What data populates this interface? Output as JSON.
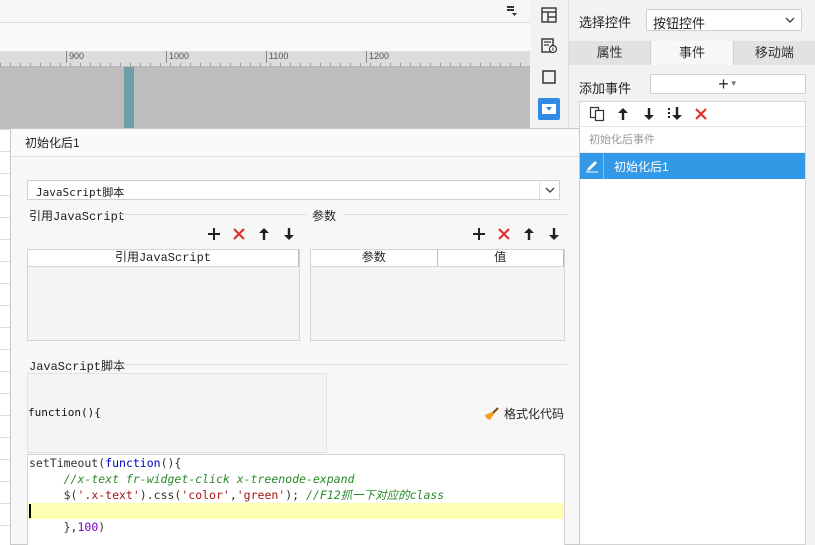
{
  "canvas": {
    "ruler_ticks": [
      "900",
      "1000",
      "1100",
      "1200"
    ]
  },
  "right_panel": {
    "select_label": "选择控件",
    "select_value": "按钮控件",
    "tabs": [
      {
        "label": "属性",
        "active": false
      },
      {
        "label": "事件",
        "active": true
      },
      {
        "label": "移动端",
        "active": false
      }
    ],
    "add_event_label": "添加事件",
    "add_event_button": "+",
    "event_group": "初始化后事件",
    "event_item": "初始化后1"
  },
  "dialog": {
    "title": "初始化后1",
    "script_type": "JavaScript脚本",
    "ref_js_title": "引用JavaScript",
    "params_title": "参数",
    "ref_js_column": "引用JavaScript",
    "params_columns": [
      "参数",
      "值"
    ],
    "js_section_title": "JavaScript脚本",
    "function_signature": "function(){",
    "format_button": "格式化代码",
    "code": {
      "line1_a": "setTimeout(",
      "line1_kw": "function",
      "line1_b": "(){",
      "line2_comment": "//x-text fr-widget-click x-treenode-expand",
      "line3_a": "$(",
      "line3_str1": "'.x-text'",
      "line3_b": ").css(",
      "line3_str2": "'color'",
      "line3_c": ",",
      "line3_str3": "'green'",
      "line3_d": "); ",
      "line3_comment": "//F12抓一下对应的class",
      "line5_a": "},",
      "line5_num": "100",
      "line5_b": ")"
    }
  },
  "colors": {
    "accent": "#3399e6",
    "delete_red": "#e03030"
  }
}
